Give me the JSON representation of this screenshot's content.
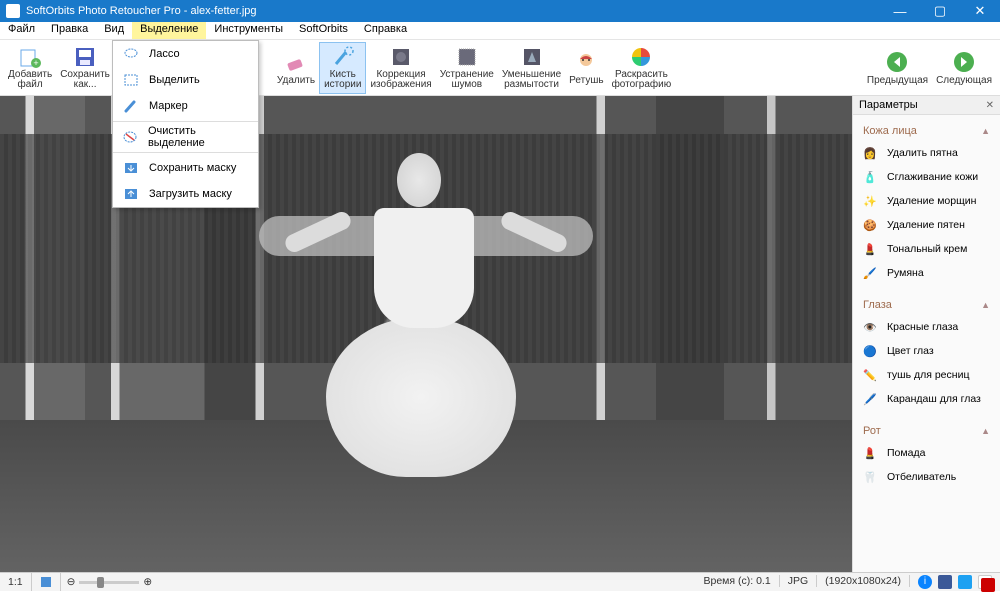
{
  "title": "SoftOrbits Photo Retoucher Pro - alex-fetter.jpg",
  "menus": {
    "file": "Файл",
    "edit": "Правка",
    "view": "Вид",
    "selection": "Выделение",
    "tools": "Инструменты",
    "softorbits": "SoftOrbits",
    "help": "Справка"
  },
  "toolbar": {
    "add_file": "Добавить\nфайл",
    "save_as": "Сохранить\nкак...",
    "delete": "Удалить",
    "history_brush": "Кисть\nистории",
    "image_correction": "Коррекция\nизображения",
    "noise_removal": "Устранение\nшумов",
    "sharpen": "Уменьшение\nразмытости",
    "retouch": "Ретушь",
    "colorize": "Раскрасить\nфотографию",
    "prev": "Предыдущая",
    "next": "Следующая"
  },
  "dropdown": {
    "lasso": "Лассо",
    "select": "Выделить",
    "marker": "Маркер",
    "clear": "Очистить выделение",
    "save_mask": "Сохранить маску",
    "load_mask": "Загрузить маску"
  },
  "panel": {
    "title": "Параметры",
    "groups": {
      "face": "Кожа лица",
      "eyes": "Глаза",
      "mouth": "Рот"
    },
    "face_items": {
      "remove_spots": "Удалить пятна",
      "skin_smooth": "Сглаживание кожи",
      "wrinkle_removal": "Удаление морщин",
      "stain_removal": "Удаление пятен",
      "foundation": "Тональный крем",
      "blush": "Румяна"
    },
    "eye_items": {
      "red_eye": "Красные глаза",
      "eye_color": "Цвет глаз",
      "mascara": "тушь для ресниц",
      "eyeliner": "Карандаш для глаз"
    },
    "mouth_items": {
      "lipstick": "Помада",
      "whitener": "Отбеливатель"
    }
  },
  "status": {
    "ratio": "1:1",
    "time": "Время (с): 0.1",
    "format": "JPG",
    "dims": "(1920x1080x24)"
  }
}
